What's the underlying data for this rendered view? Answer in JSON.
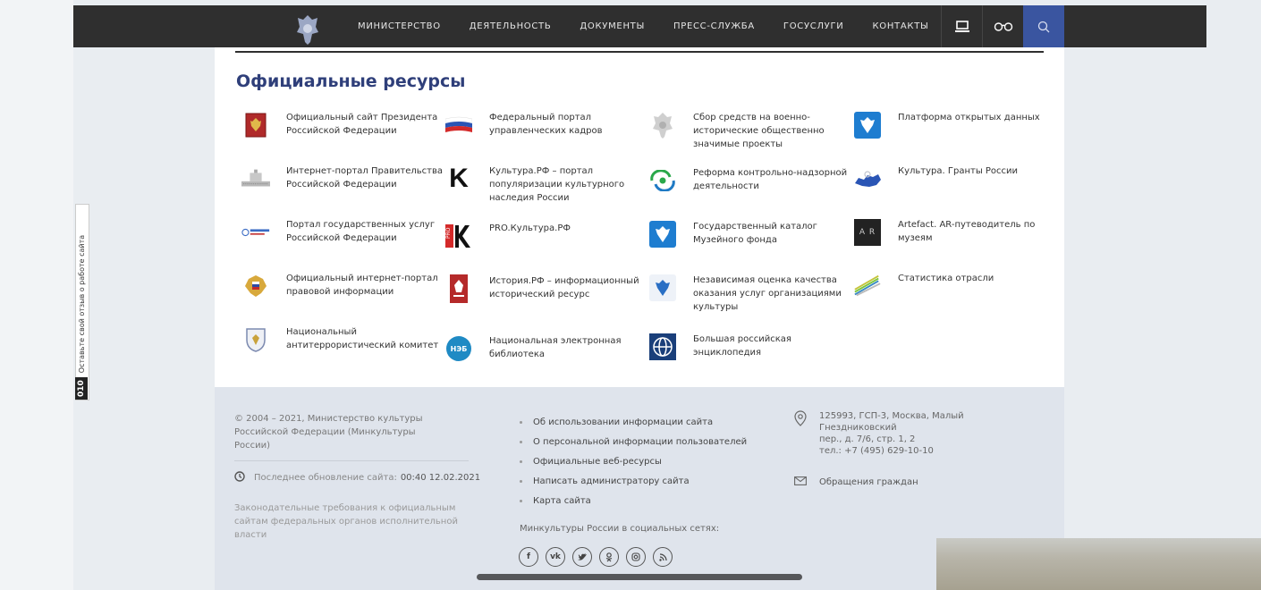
{
  "header": {
    "nav": [
      "МИНИСТЕРСТВО",
      "ДЕЯТЕЛЬНОСТЬ",
      "ДОКУМЕНТЫ",
      "ПРЕСС-СЛУЖБА",
      "ГОСУСЛУГИ",
      "КОНТАКТЫ"
    ]
  },
  "main": {
    "title": "Официальные ресурсы",
    "resources": [
      {
        "label": "Официальный сайт Президента Российской Федерации",
        "icon": "president-emblem-icon"
      },
      {
        "label": "Федеральный портал управленческих кадров",
        "icon": "russian-flag-icon"
      },
      {
        "label": "Сбор средств на военно-исторические общественно значимые проекты",
        "icon": "military-emblem-icon"
      },
      {
        "label": "Платформа открытых данных",
        "icon": "eagle-shield-icon"
      },
      {
        "label": "Интернет-портал Правительства Российской Федерации",
        "icon": "government-building-icon"
      },
      {
        "label": "Культура.РФ – портал популяризации культурного наследия России",
        "icon": "kultura-k-icon"
      },
      {
        "label": "Реформа контрольно-надзорной деятельности",
        "icon": "reform-arrows-icon"
      },
      {
        "label": "Культура. Гранты России",
        "icon": "russia-map-icon"
      },
      {
        "label": "Портал государственных услуг Российской Федерации",
        "icon": "gosuslugi-logo-icon"
      },
      {
        "label": "PRO.Культура.РФ",
        "icon": "pro-kultura-icon"
      },
      {
        "label": "Государственный каталог Музейного фонда",
        "icon": "eagle-shield-icon"
      },
      {
        "label": "Artefact. AR-путеводитель по музеям",
        "icon": "ar-logo-icon"
      },
      {
        "label": "Официальный интернет-портал правовой информации",
        "icon": "legal-emblem-icon"
      },
      {
        "label": "История.РФ – информационный исторический ресурс",
        "icon": "history-logo-icon"
      },
      {
        "label": "Независимая оценка качества оказания услуг организациями культуры",
        "icon": "eagle-shield-icon"
      },
      {
        "label": "Статистика отрасли",
        "icon": "statistics-icon"
      },
      {
        "label": "Национальный антитеррористический комитет",
        "icon": "nak-shield-icon"
      },
      {
        "label": "Национальная электронная библиотека",
        "icon": "neb-logo-icon"
      },
      {
        "label": "Большая российская энциклопедия",
        "icon": "encyclopedia-logo-icon"
      }
    ],
    "neb_badge": "НЭБ",
    "ar_badge": "A R",
    "pro_badge": "PRO",
    "k_letter": "K"
  },
  "footer": {
    "copyright": "© 2004 – 2021, Министерство культуры Российской Федерации (Минкультуры России)",
    "updated_label": "Последнее обновление сайта:",
    "updated_value": "00:40 12.02.2021",
    "law": "Законодательные требования к официальным сайтам федеральных органов исполнительной власти",
    "links": [
      "Об использовании информации сайта",
      "О персональной информации пользователей",
      "Официальные веб-ресурсы",
      "Написать администратору сайта",
      "Карта сайта"
    ],
    "social_title": "Минкультуры России в социальных сетях:",
    "social": [
      "f",
      "vk",
      "tw",
      "ok",
      "ig",
      "rss"
    ],
    "address_line1": "125993, ГСП-3, Москва, Малый Гнездниковский",
    "address_line2": "пер., д. 7/6, стр. 1, 2",
    "address_line3": "тел.: +7 (495) 629-10-10",
    "appeals": "Обращения граждан"
  },
  "feedback": {
    "number": "010",
    "label": "Оставьте свой отзыв о работе сайта"
  },
  "colors": {
    "topbar": "#2f2f2f",
    "accent": "#3a55a0",
    "title": "#2f3f7a",
    "footer_bg": "#dfe4ec"
  }
}
